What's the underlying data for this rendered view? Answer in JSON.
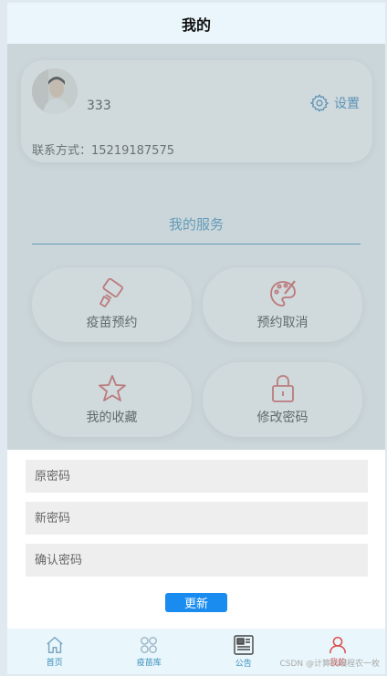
{
  "header": {
    "title": "我的"
  },
  "profile": {
    "username": "333",
    "settings_label": "设置",
    "contact_label": "联系方式：",
    "contact_value": "15219187575"
  },
  "services": {
    "title": "我的服务",
    "items": [
      {
        "label": "疫苗预约",
        "icon": "vaccine-icon"
      },
      {
        "label": "预约取消",
        "icon": "palette-icon"
      },
      {
        "label": "我的收藏",
        "icon": "star-icon"
      },
      {
        "label": "修改密码",
        "icon": "lock-icon"
      }
    ]
  },
  "password_form": {
    "old_placeholder": "原密码",
    "new_placeholder": "新密码",
    "confirm_placeholder": "确认密码",
    "submit_label": "更新"
  },
  "tabbar": {
    "items": [
      {
        "label": "首页",
        "icon": "home-icon",
        "active": false
      },
      {
        "label": "疫苗库",
        "icon": "grid-icon",
        "active": false
      },
      {
        "label": "公告",
        "icon": "newspaper-icon",
        "active": false
      },
      {
        "label": "我的",
        "icon": "user-icon",
        "active": true
      }
    ]
  },
  "watermark": "CSDN @计算机编程农一枚",
  "colors": {
    "accent": "#3a8ebd",
    "icon_red": "#d9534f",
    "button_blue": "#1a8cf0"
  }
}
